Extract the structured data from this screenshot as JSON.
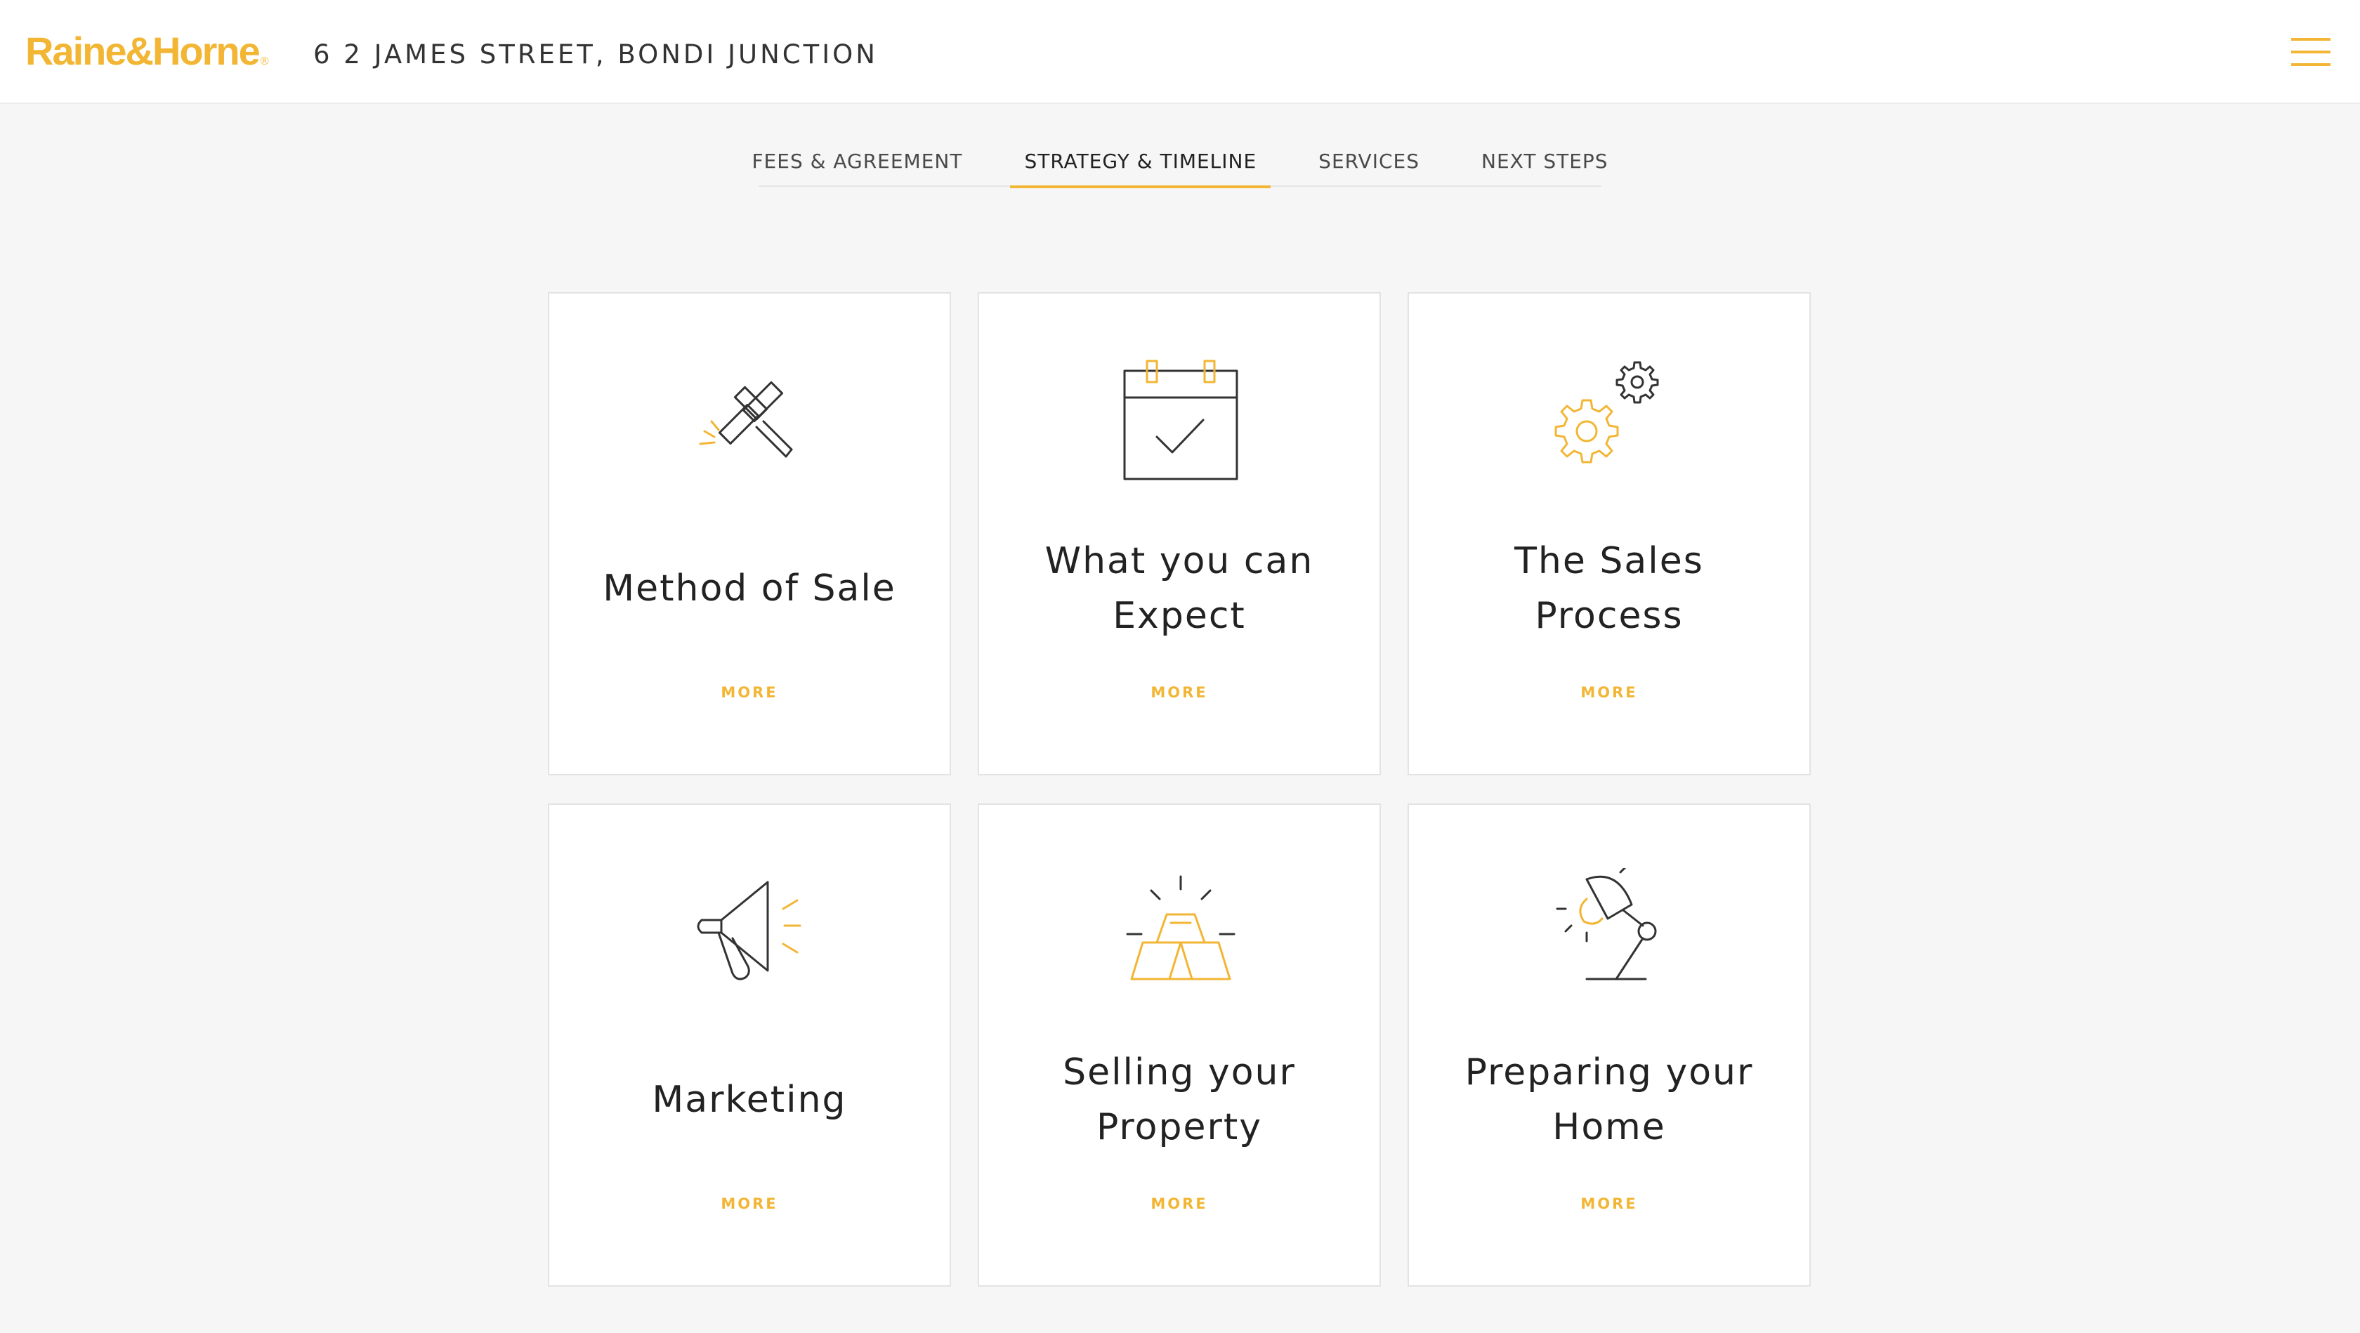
{
  "brand": {
    "logo_text": "Raine&Horne",
    "logo_mark": "®",
    "accent_color": "#f2b634"
  },
  "header": {
    "address": "6 2 JAMES STREET, BONDI JUNCTION",
    "menu_icon": "hamburger-menu-icon"
  },
  "tabs": [
    {
      "label": "FEES & AGREEMENT",
      "active": false
    },
    {
      "label": "STRATEGY & TIMELINE",
      "active": true
    },
    {
      "label": "SERVICES",
      "active": false
    },
    {
      "label": "NEXT STEPS",
      "active": false
    }
  ],
  "cards": [
    {
      "title": "Method of Sale",
      "more": "MORE",
      "icon": "gavel-icon"
    },
    {
      "title": "What you can Expect",
      "more": "MORE",
      "icon": "calendar-check-icon"
    },
    {
      "title": "The Sales Process",
      "more": "MORE",
      "icon": "gears-icon"
    },
    {
      "title": "Marketing",
      "more": "MORE",
      "icon": "megaphone-icon"
    },
    {
      "title": "Selling your Property",
      "more": "MORE",
      "icon": "gold-bars-icon"
    },
    {
      "title": "Preparing your Home",
      "more": "MORE",
      "icon": "desk-lamp-icon"
    }
  ]
}
